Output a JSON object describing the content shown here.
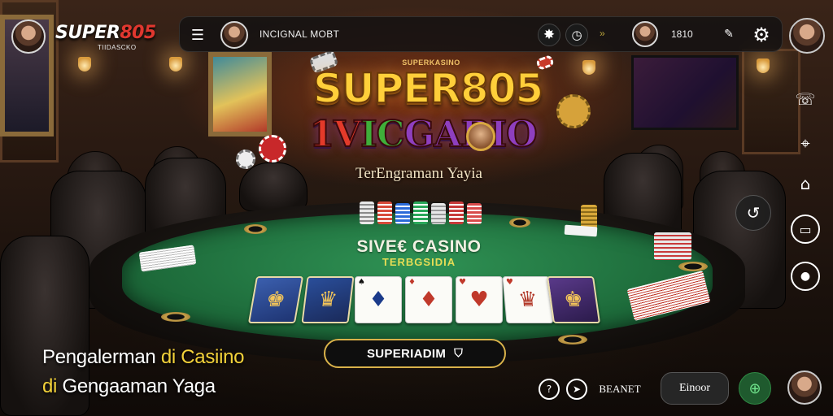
{
  "brand": {
    "name_part1": "SUPER",
    "name_part2": "805",
    "subtitle": "TIIDASCKO"
  },
  "topbar": {
    "menu_icon": "hamburger-icon",
    "username": "INCIGNAL MOBT",
    "icons": [
      "gear-burst-icon",
      "timer-icon"
    ],
    "small_arrow": "»",
    "balance": "1810",
    "edit_icon": "pen-icon",
    "settings_icon": "gear-icon"
  },
  "hero": {
    "tag": "SUPERKASINO",
    "logo": "SUPER805",
    "sub_parts": [
      "1",
      "V",
      "IC",
      "G",
      "ABIO"
    ],
    "tagline": "TerEngramanı Yayia"
  },
  "felt": {
    "title": "SIVE€ CASINO",
    "subtitle": "TERBGSIDIA"
  },
  "side_icons": [
    "support-icon",
    "location-pin-icon",
    "gift-icon",
    "refresh-hand-icon",
    "card-icon",
    "pin-icon"
  ],
  "promo": {
    "line1_white": "Pengalerman ",
    "line1_yellow": "di Casiino",
    "line2_yellow": "di ",
    "line2_white": "Gengaaman Yaga"
  },
  "cta": {
    "label": "SUPERIADIM",
    "icon": "shield-icon"
  },
  "bottom_bar": {
    "help_icon": "help-icon",
    "share_icon": "share-icon",
    "label": "BEANET",
    "pill_label": "Einoor",
    "game_icon": "gamepad-icon"
  },
  "colors": {
    "accent_gold": "#d9b24a",
    "felt_green": "#2f9254",
    "brand_red": "#e0372f",
    "promo_yellow": "#f3d23a"
  }
}
